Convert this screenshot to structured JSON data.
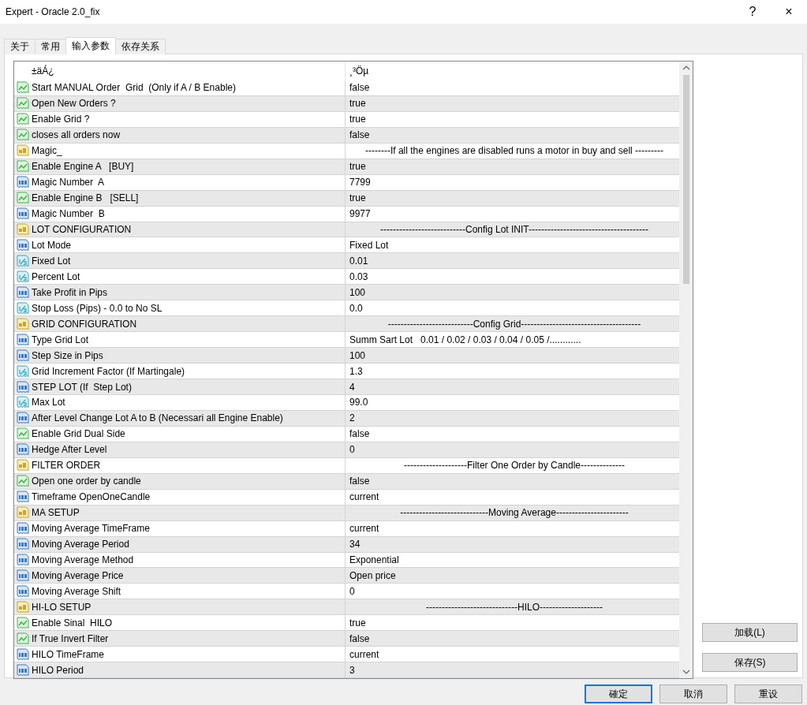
{
  "window": {
    "title": "Expert - Oracle 2.0_fix",
    "help": "?",
    "close": "×"
  },
  "tabs": [
    {
      "label": "关于",
      "selected": false
    },
    {
      "label": "常用",
      "selected": false
    },
    {
      "label": "输入参数",
      "selected": true
    },
    {
      "label": "依存关系",
      "selected": false
    }
  ],
  "table": {
    "columns": [
      "±äÁ¿",
      "¸³Öµ"
    ],
    "rows": [
      {
        "kind": "bool",
        "name": "Start MANUAL Order  Grid  (Only if A / B Enable)",
        "value": "false"
      },
      {
        "kind": "bool",
        "name": "Open New Orders ?",
        "value": "true"
      },
      {
        "kind": "bool",
        "name": "Enable Grid ?",
        "value": "true"
      },
      {
        "kind": "bool",
        "name": "closes all orders now",
        "value": "false"
      },
      {
        "kind": "string",
        "name": "Magic_",
        "value": "--------If all the engines are disabled runs a motor in buy and sell ---------"
      },
      {
        "kind": "bool",
        "name": "Enable Engine A   [BUY]",
        "value": "true"
      },
      {
        "kind": "int",
        "name": "Magic Number  A",
        "value": "7799"
      },
      {
        "kind": "bool",
        "name": "Enable Engine B   [SELL]",
        "value": "true"
      },
      {
        "kind": "int",
        "name": "Magic Number  B",
        "value": "9977"
      },
      {
        "kind": "string",
        "name": "LOT CONFIGURATION",
        "value": "---------------------------Config Lot INIT--------------------------------------"
      },
      {
        "kind": "int",
        "name": "Lot Mode",
        "value": "Fixed Lot"
      },
      {
        "kind": "double",
        "name": "Fixed Lot",
        "value": "0.01"
      },
      {
        "kind": "double",
        "name": "Percent Lot",
        "value": "0.03"
      },
      {
        "kind": "int",
        "name": "Take Profit in Pips",
        "value": "100"
      },
      {
        "kind": "double",
        "name": "Stop Loss (Pips) - 0.0 to No SL",
        "value": "0.0"
      },
      {
        "kind": "string",
        "name": "GRID CONFIGURATION",
        "value": "---------------------------Config Grid--------------------------------------"
      },
      {
        "kind": "int",
        "name": "Type Grid Lot",
        "value": "Summ Sart Lot   0.01 / 0.02 / 0.03 / 0.04 / 0.05 /............"
      },
      {
        "kind": "int",
        "name": "Step Size in Pips",
        "value": "100"
      },
      {
        "kind": "double",
        "name": "Grid Increment Factor (If Martingale)",
        "value": "1.3"
      },
      {
        "kind": "int",
        "name": "STEP LOT (If  Step Lot)",
        "value": "4"
      },
      {
        "kind": "double",
        "name": "Max Lot",
        "value": "99.0"
      },
      {
        "kind": "int",
        "name": "After Level Change Lot A to B (Necessari all Engine Enable)",
        "value": "2"
      },
      {
        "kind": "bool",
        "name": "Enable Grid Dual Side",
        "value": "false"
      },
      {
        "kind": "int",
        "name": "Hedge After Level",
        "value": "0"
      },
      {
        "kind": "string",
        "name": "FILTER ORDER",
        "value": "--------------------Filter One Order by Candle--------------"
      },
      {
        "kind": "bool",
        "name": "Open one order by candle",
        "value": "false"
      },
      {
        "kind": "int",
        "name": "Timeframe OpenOneCandle",
        "value": "current"
      },
      {
        "kind": "string",
        "name": "MA SETUP",
        "value": "----------------------------Moving Average-----------------------"
      },
      {
        "kind": "int",
        "name": "Moving Average TimeFrame",
        "value": "current"
      },
      {
        "kind": "int",
        "name": "Moving Average Period",
        "value": "34"
      },
      {
        "kind": "int",
        "name": "Moving Average Method",
        "value": "Exponential"
      },
      {
        "kind": "int",
        "name": "Moving Average Price",
        "value": "Open price"
      },
      {
        "kind": "int",
        "name": "Moving Average Shift",
        "value": "0"
      },
      {
        "kind": "string",
        "name": "HI-LO SETUP",
        "value": "-----------------------------HILO--------------------"
      },
      {
        "kind": "bool",
        "name": "Enable Sinal  HILO",
        "value": "true"
      },
      {
        "kind": "bool",
        "name": "If True Invert Filter",
        "value": "false"
      },
      {
        "kind": "int",
        "name": "HILO TimeFrame",
        "value": "current"
      },
      {
        "kind": "int",
        "name": "HILO Period",
        "value": "3"
      }
    ]
  },
  "side_buttons": [
    "加载(L)",
    "保存(S)"
  ],
  "buttons": [
    {
      "label": "確定",
      "default": true
    },
    {
      "label": "取消",
      "default": false
    },
    {
      "label": "重设",
      "default": false
    }
  ]
}
